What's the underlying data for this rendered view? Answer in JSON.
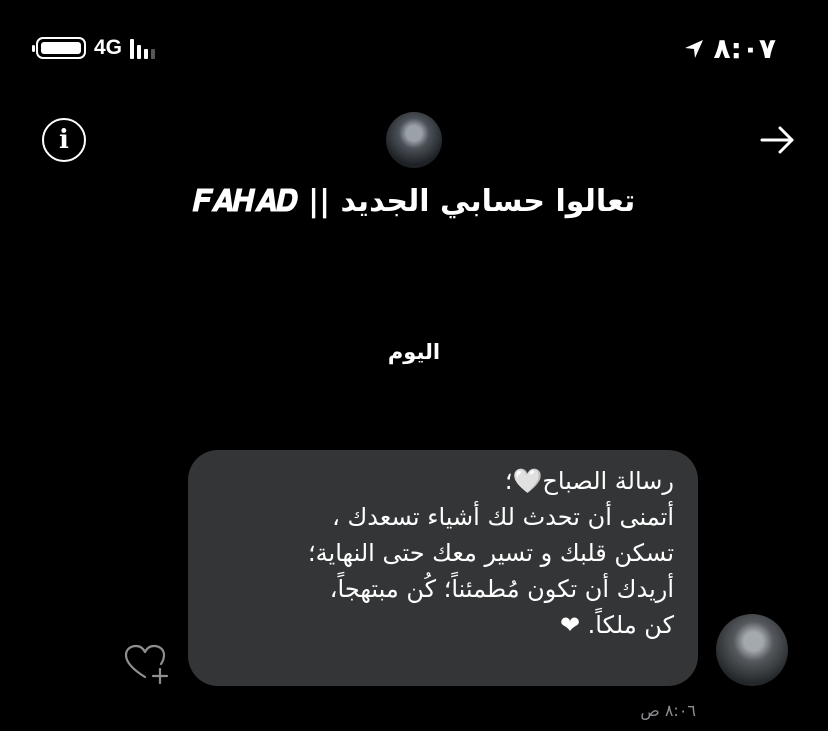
{
  "status_bar": {
    "network": "4G",
    "time": "٨:٠٧"
  },
  "header": {
    "chat_title": "تعالوا حسابي الجديد || 𝑭𝑨𝑯𝑨𝑫",
    "info_icon": "info-icon",
    "back_icon": "arrow-right-icon"
  },
  "date_separator": "اليوم",
  "message": {
    "lines": [
      "رسالة الصباح🤍؛",
      "أتمنى أن تحدث لك أشياء تسعدك ،",
      "تسكن قلبك و تسير معك حتى النهاية؛",
      "أريدك أن تكون مُطمئناً؛ كُن مبتهجاً،",
      "كن ملكاً. ❤"
    ],
    "timestamp": "٨:٠٦ ص"
  },
  "colors": {
    "background": "#000000",
    "bubble": "#343536",
    "text": "#ffffff",
    "timestamp": "#8e8e93"
  }
}
